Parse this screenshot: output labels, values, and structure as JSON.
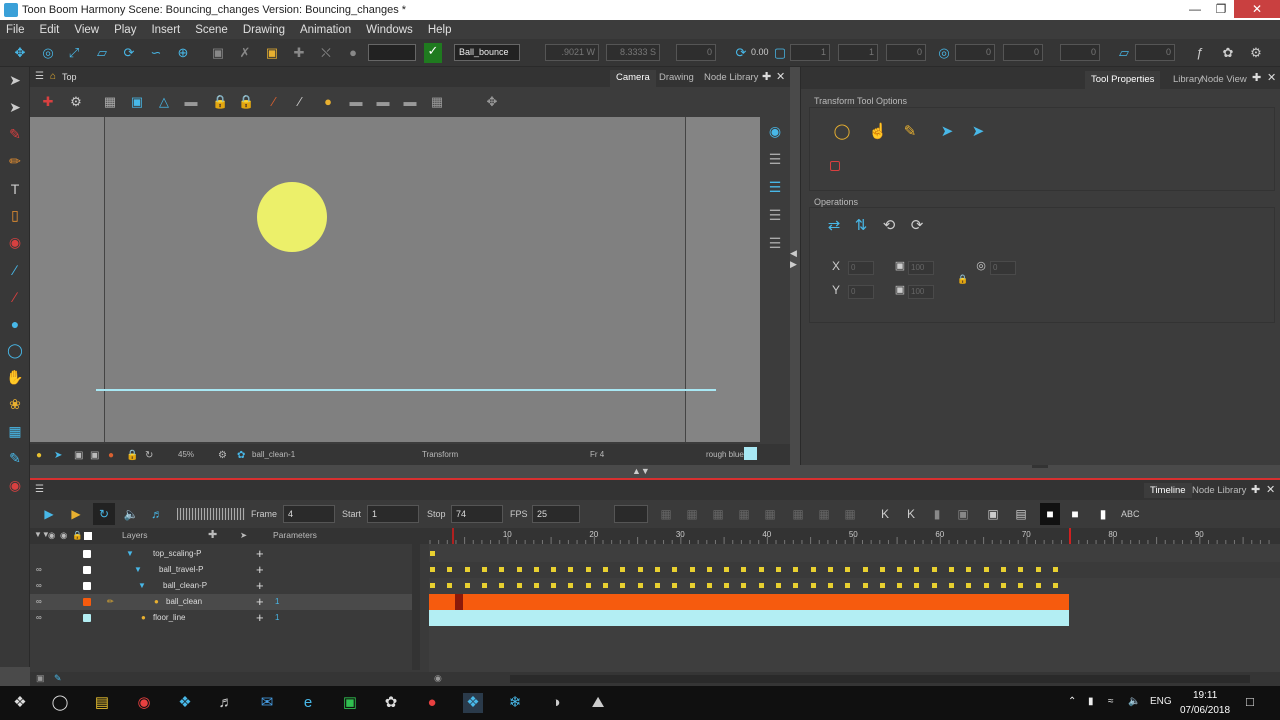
{
  "window": {
    "title": "Toon Boom Harmony Scene: Bouncing_changes Version: Bouncing_changes *"
  },
  "menu": [
    "File",
    "Edit",
    "View",
    "Play",
    "Insert",
    "Scene",
    "Drawing",
    "Animation",
    "Windows",
    "Help"
  ],
  "toolbar": {
    "drawing_select": "Ball_bounce",
    "field_w": ".9021 W",
    "field_s": "8.3333 S",
    "field_a": "0",
    "rotation_value": "0.00",
    "field_1": "1",
    "field_2": "1",
    "field_3": "0",
    "field_4": "0",
    "field_5": "0",
    "field_6": "0",
    "field_7": "0"
  },
  "camera_panel": {
    "title": "Top",
    "tabs": [
      "Camera",
      "Drawing",
      "Node Library"
    ],
    "status": {
      "zoom": "45%",
      "node": "ball_clean-1",
      "tool": "Transform",
      "frame": "Fr 4",
      "palette_color": "rough blue",
      "palette_swatch_color": "#a8e8f4"
    },
    "ball_color": "#ecf06a",
    "floor_color": "#a8e8f4"
  },
  "props_panel": {
    "tabs": [
      "Tool Properties",
      "Library",
      "Node View"
    ],
    "section_title": "Transform Tool Options",
    "operations_title": "Operations",
    "fields": {
      "x": "0",
      "y": "0",
      "w": "100",
      "h": "100",
      "angle": "0"
    }
  },
  "timeline": {
    "tabs": [
      "Timeline",
      "Node Library"
    ],
    "frame_label": "Frame",
    "frame_value": "4",
    "start_label": "Start",
    "start_value": "1",
    "stop_label": "Stop",
    "stop_value": "74",
    "fps_label": "FPS",
    "fps_value": "25",
    "layers_header": "Layers",
    "parameters_header": "Parameters",
    "ruler_ticks": [
      "10",
      "20",
      "30",
      "40",
      "50",
      "60",
      "70",
      "80",
      "90"
    ],
    "layers": [
      {
        "name": "top_scaling-P",
        "num": ""
      },
      {
        "name": "ball_travel-P",
        "num": ""
      },
      {
        "name": "ball_clean-P",
        "num": ""
      },
      {
        "name": "ball_clean",
        "num": "1"
      },
      {
        "name": "floor_line",
        "num": "1"
      }
    ],
    "current_frame": 4,
    "stop_frame": 74,
    "ball_clean_color": "#f65b0e",
    "floor_line_color": "#b3eef3"
  },
  "taskbar": {
    "language": "ENG",
    "time": "19:11",
    "date": "07/06/2018"
  }
}
